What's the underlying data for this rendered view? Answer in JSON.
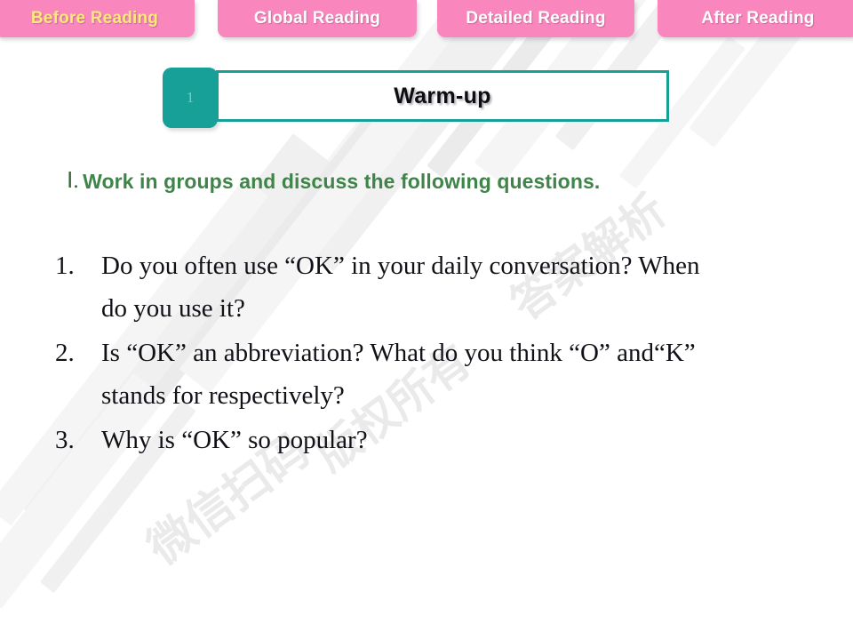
{
  "theme": {
    "tab_pink": "#f986bd",
    "tab_text": "#ffffff",
    "tab_text_active": "#ffe87a",
    "teal": "#17a098",
    "heading_green": "#3f8449",
    "body_text": "#111118",
    "background": "#ffffff"
  },
  "tabs": [
    {
      "label": "Before Reading",
      "active": true
    },
    {
      "label": "Global Reading",
      "active": false
    },
    {
      "label": "Detailed Reading",
      "active": false
    },
    {
      "label": "After Reading",
      "active": false
    }
  ],
  "section": {
    "number": "1",
    "title": "Warm-up"
  },
  "heading": {
    "numeral": "Ⅰ",
    "separator": ".",
    "text": "Work in groups and discuss the following questions."
  },
  "questions": [
    {
      "number": "1.",
      "lines": [
        "Do you often use “OK” in your daily conversation?   When",
        "do you use it?"
      ]
    },
    {
      "number": "2.",
      "lines": [
        "Is “OK” an abbreviation? What do you think “O” and“K”",
        "stands for respectively?"
      ]
    },
    {
      "number": "3.",
      "lines": [
        "Why is “OK” so popular?"
      ]
    }
  ],
  "watermark": {
    "text_1": "微信扫码",
    "text_2": "版权所有",
    "text_3": "答案解析"
  }
}
